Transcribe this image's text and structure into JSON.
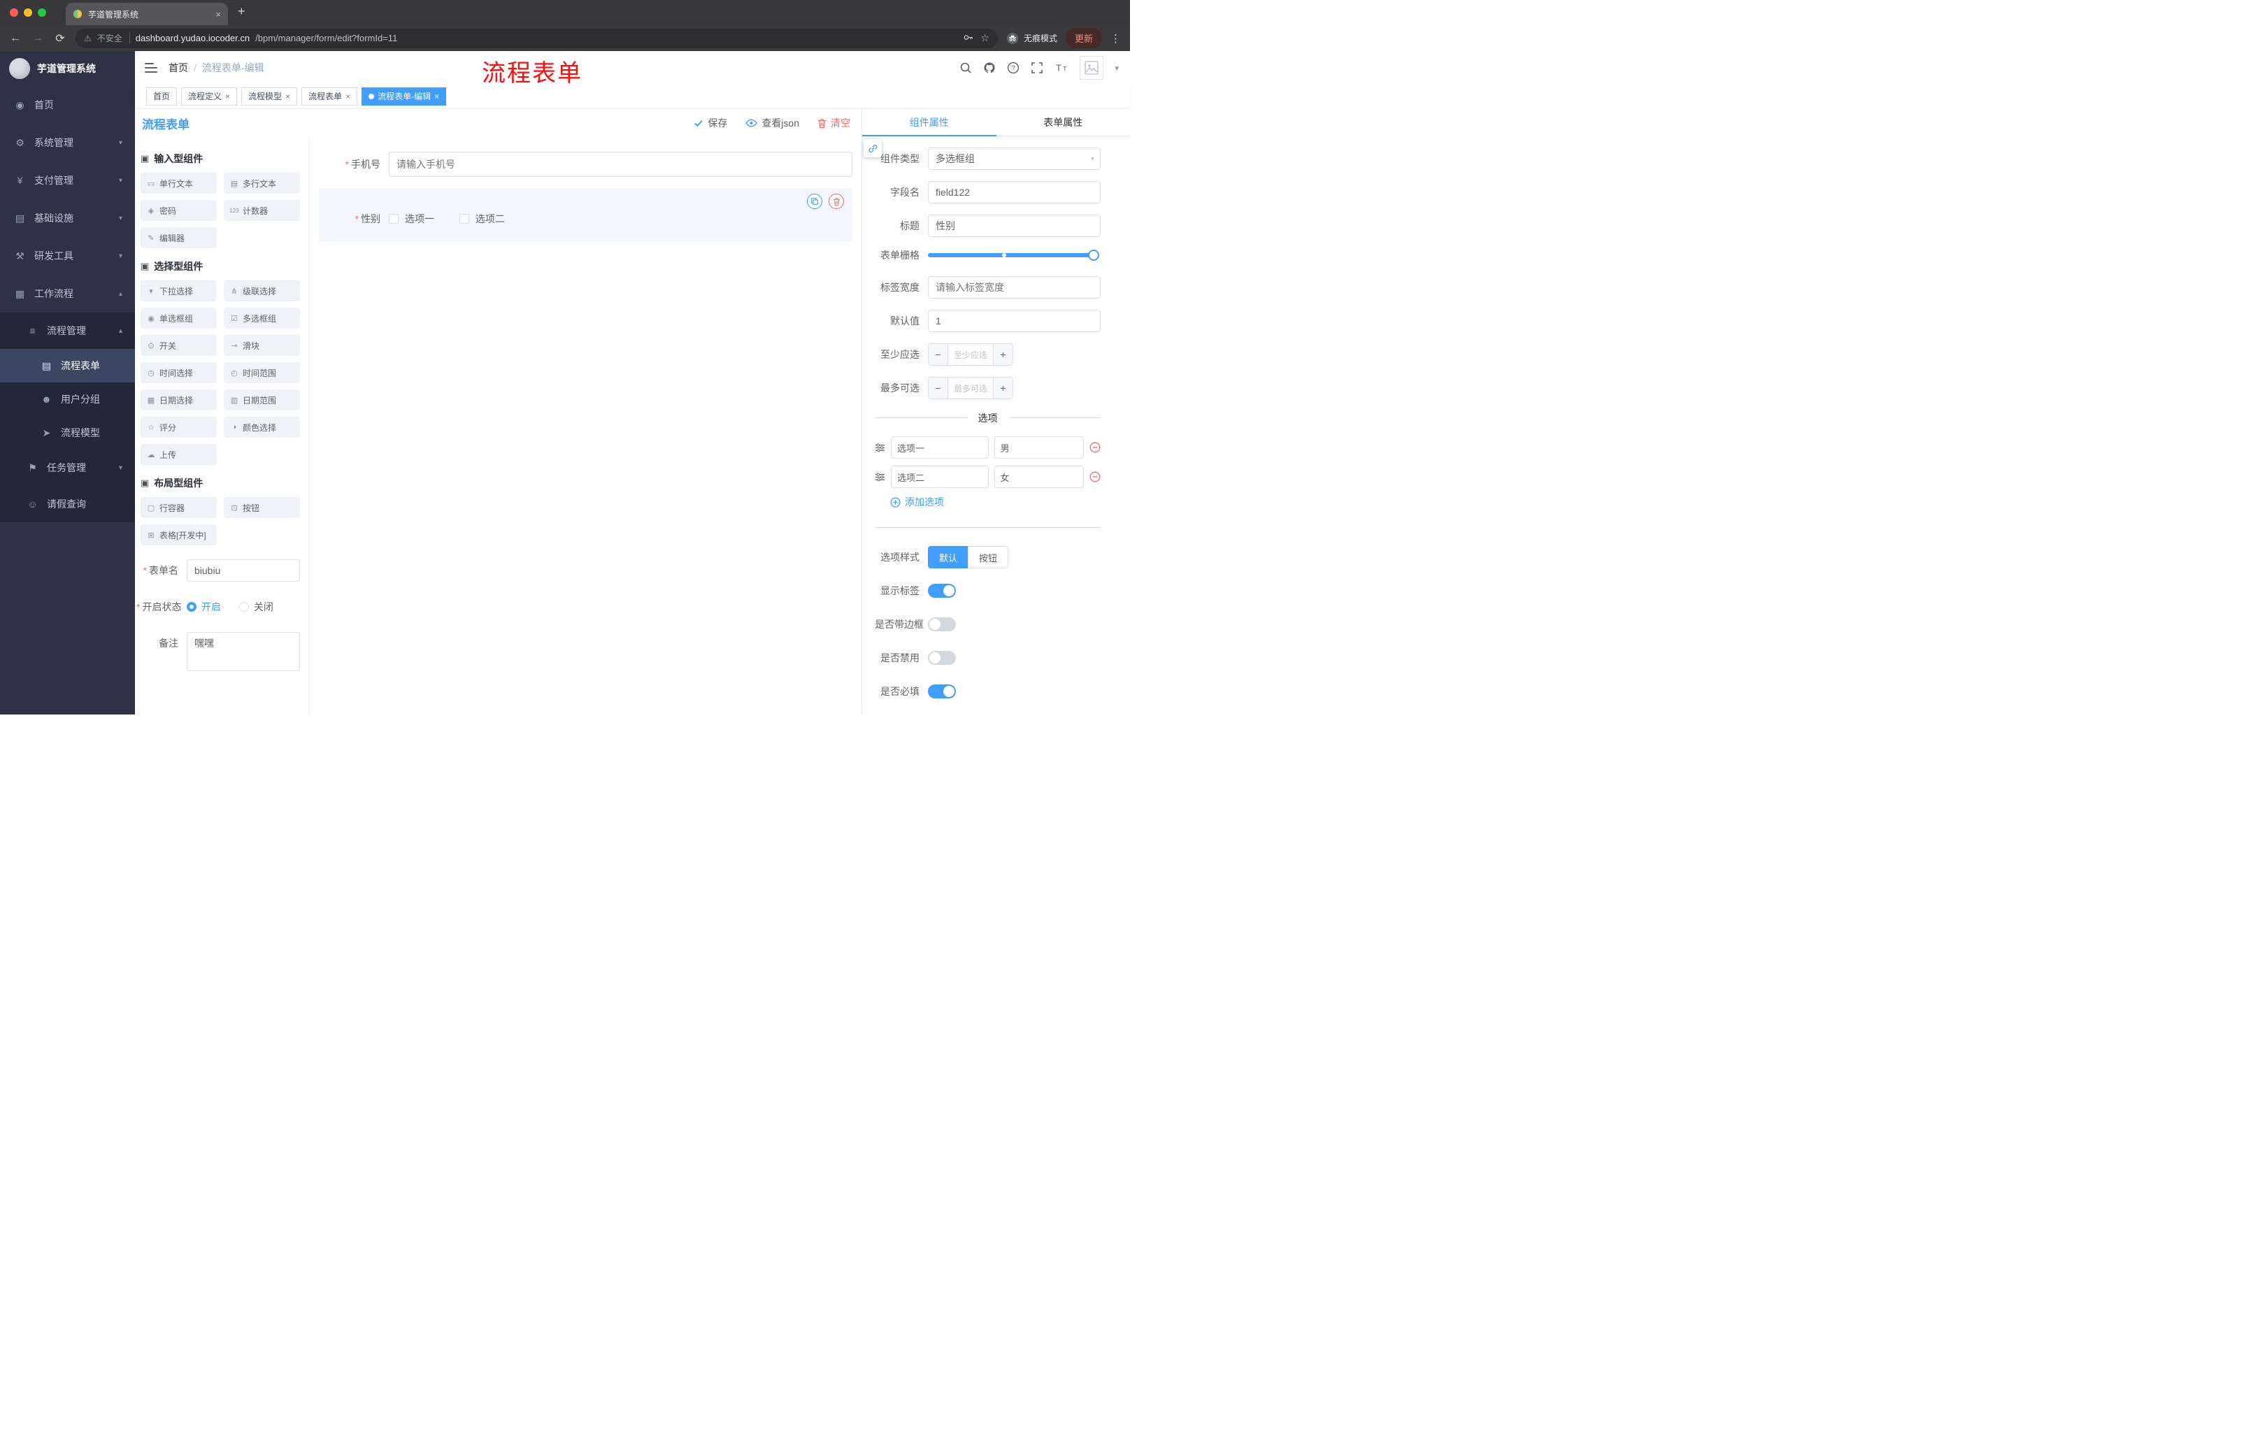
{
  "ui": {
    "asterisk": "*",
    "breadcrumb_sep": "/",
    "close": "×",
    "newtab": "+",
    "back": "←",
    "forward": "→",
    "reload": "⟳",
    "star": "☆",
    "menu": "⋮",
    "caret_down": "▾",
    "warning": "⚠",
    "minus": "−",
    "plus": "+"
  },
  "colors": {
    "accent": "#409eff",
    "danger": "#f56c6c",
    "sidebar_bg": "#2d3245",
    "sidebar_sub_bg": "#232838",
    "annotation_red": "#fb0e0c",
    "chrome_bg": "#3a3a3c"
  },
  "browser": {
    "tab_title": "芋道管理系统",
    "security": "不安全",
    "url_domain": "dashboard.yudao.iocoder.cn",
    "url_path": "/bpm/manager/form/edit?formId=11",
    "incognito": "无痕模式",
    "update": "更新"
  },
  "sidebar": {
    "title": "芋道管理系统",
    "items": [
      {
        "label": "首页",
        "icon": "dashboard-icon",
        "glyph": "◉"
      },
      {
        "label": "系统管理",
        "icon": "gear-icon",
        "glyph": "⚙",
        "chevron": "▾"
      },
      {
        "label": "支付管理",
        "icon": "yen-icon",
        "glyph": "¥",
        "chevron": "▾"
      },
      {
        "label": "基础设施",
        "icon": "monitor-icon",
        "glyph": "▤",
        "chevron": "▾"
      },
      {
        "label": "研发工具",
        "icon": "tools-icon",
        "glyph": "⚒",
        "chevron": "▾"
      },
      {
        "label": "工作流程",
        "icon": "workflow-icon",
        "glyph": "▦",
        "chevron": "▴"
      },
      {
        "label": "流程管理",
        "icon": "process-list-icon",
        "glyph": "≡",
        "chevron": "▴"
      },
      {
        "label": "流程表单",
        "icon": "form-icon",
        "glyph": "▤"
      },
      {
        "label": "用户分组",
        "icon": "user-group-icon",
        "glyph": "☻"
      },
      {
        "label": "流程模型",
        "icon": "send-icon",
        "glyph": "➤"
      },
      {
        "label": "任务管理",
        "icon": "flag-icon",
        "glyph": "⚑",
        "chevron": "▾"
      },
      {
        "label": "请假查询",
        "icon": "person-icon",
        "glyph": "☺"
      }
    ]
  },
  "header": {
    "breadcrumb_home": "首页",
    "breadcrumb_current": "流程表单-编辑",
    "annotation": "流程表单"
  },
  "view_tabs": [
    {
      "label": "首页"
    },
    {
      "label": "流程定义"
    },
    {
      "label": "流程模型"
    },
    {
      "label": "流程表单"
    },
    {
      "label": "流程表单-编辑"
    }
  ],
  "designer": {
    "title": "流程表单",
    "save": "保存",
    "view_json": "查看json",
    "clear": "清空"
  },
  "palette": {
    "groups": [
      {
        "title": "输入型组件",
        "glyph": "▣",
        "items": [
          {
            "label": "单行文本",
            "icon": "single-line-text-icon",
            "glyph": "▭"
          },
          {
            "label": "多行文本",
            "icon": "multi-line-text-icon",
            "glyph": "▤"
          },
          {
            "label": "密码",
            "icon": "password-lock-icon",
            "glyph": "◈"
          },
          {
            "label": "计数器",
            "icon": "counter-icon",
            "glyph": "123"
          },
          {
            "label": "编辑器",
            "icon": "editor-icon",
            "glyph": "✎"
          }
        ]
      },
      {
        "title": "选择型组件",
        "glyph": "▣",
        "items": [
          {
            "label": "下拉选择",
            "icon": "select-icon",
            "glyph": "▾"
          },
          {
            "label": "级联选择",
            "icon": "cascader-icon",
            "glyph": "⋔"
          },
          {
            "label": "单选框组",
            "icon": "radio-group-icon",
            "glyph": "◉"
          },
          {
            "label": "多选框组",
            "icon": "checkbox-group-icon",
            "glyph": "☑"
          },
          {
            "label": "开关",
            "icon": "switch-icon",
            "glyph": "⊙"
          },
          {
            "label": "滑块",
            "icon": "slider-icon",
            "glyph": "⊸"
          },
          {
            "label": "时间选择",
            "icon": "time-picker-icon",
            "glyph": "◷"
          },
          {
            "label": "时间范围",
            "icon": "time-range-icon",
            "glyph": "◴"
          },
          {
            "label": "日期选择",
            "icon": "date-picker-icon",
            "glyph": "▦"
          },
          {
            "label": "日期范围",
            "icon": "date-range-icon",
            "glyph": "▥"
          },
          {
            "label": "评分",
            "icon": "rate-icon",
            "glyph": "☆"
          },
          {
            "label": "颜色选择",
            "icon": "color-picker-icon",
            "glyph": "◑"
          },
          {
            "label": "上传",
            "icon": "upload-icon",
            "glyph": "☁"
          }
        ]
      },
      {
        "title": "布局型组件",
        "glyph": "▣",
        "items": [
          {
            "label": "行容器",
            "icon": "row-container-icon",
            "glyph": "▢"
          },
          {
            "label": "按钮",
            "icon": "button-icon",
            "glyph": "⊡"
          },
          {
            "label": "表格[开发中]",
            "icon": "table-icon",
            "glyph": "⊞"
          }
        ]
      }
    ]
  },
  "form_meta": {
    "name_label": "表单名",
    "name_value": "biubiu",
    "status_label": "开启状态",
    "status_on": "开启",
    "status_off": "关闭",
    "remark_label": "备注",
    "remark_value": "嘿嘿"
  },
  "canvas": {
    "phone_label": "手机号",
    "phone_placeholder": "请输入手机号",
    "gender_label": "性别",
    "gender_options": [
      "选项一",
      "选项二"
    ]
  },
  "properties": {
    "tab_component": "组件属性",
    "tab_form": "表单属性",
    "type_label": "组件类型",
    "type_value": "多选框组",
    "field_label": "字段名",
    "field_value": "field122",
    "title_label": "标题",
    "title_value": "性别",
    "grid_label": "表单栅格",
    "label_width_label": "标签宽度",
    "label_width_placeholder": "请输入标签宽度",
    "default_label": "默认值",
    "default_value": "1",
    "min_label": "至少应选",
    "min_placeholder": "至少应选",
    "max_label": "最多可选",
    "max_placeholder": "最多可选",
    "options_title": "选项",
    "options": [
      {
        "label": "选项一",
        "value": "男"
      },
      {
        "label": "选项二",
        "value": "女"
      }
    ],
    "add_option": "添加选项",
    "style_label": "选项样式",
    "style_options": [
      "默认",
      "按钮"
    ],
    "show_label_label": "显示标签",
    "border_label": "是否带边框",
    "disabled_label": "是否禁用",
    "required_label": "是否必填"
  }
}
